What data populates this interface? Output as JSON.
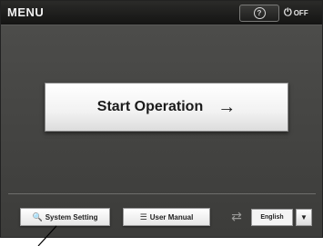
{
  "header": {
    "title": "MENU",
    "help_icon": "?",
    "power_icon": "⏻",
    "power_label": "OFF"
  },
  "main": {
    "start_label": "Start Operation",
    "start_arrow": "→"
  },
  "footer": {
    "system_setting_icon": "🔍",
    "system_setting_label": "System Setting",
    "user_manual_icon": "☰",
    "user_manual_label": "User Manual",
    "language_icon": "⇄",
    "language_value": "English",
    "language_arrow": "▼"
  },
  "colors": {
    "screen_bg": "#474745",
    "topbar_bg": "#1a1a19",
    "button_bg": "#ffffff"
  }
}
